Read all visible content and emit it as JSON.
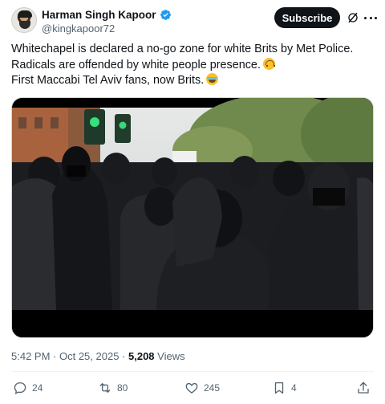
{
  "author": {
    "display_name": "Harman Singh Kapoor",
    "handle": "@kingkapoor72",
    "verified": true
  },
  "header": {
    "subscribe_label": "Subscribe",
    "grok_icon": "grok-icon",
    "more_icon": "more-icon"
  },
  "tweet": {
    "lines": [
      "Whitechapel is declared a no-go zone for white Brits by Met Police.",
      "Radicals are offended by white people presence.",
      "First Maccabi Tel Aviv fans, now Brits."
    ],
    "emoji_line2": "upside-down-face",
    "emoji_line3": "face-with-tears-of-joy"
  },
  "media": {
    "description_icon": "video-thumbnail"
  },
  "meta": {
    "time": "5:42 PM",
    "separator": " · ",
    "date": "Oct 25, 2025",
    "views_count": "5,208",
    "views_label": " Views"
  },
  "actions": {
    "replies": "24",
    "reposts": "80",
    "likes": "245",
    "bookmarks": "4"
  },
  "colors": {
    "text_primary": "#0f1419",
    "text_secondary": "#536471",
    "verified_blue": "#1d9bf0",
    "subscribe_bg": "#0f1419"
  }
}
